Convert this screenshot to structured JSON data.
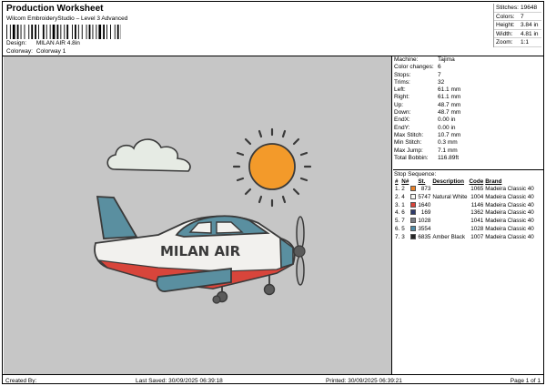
{
  "header": {
    "title": "Production Worksheet",
    "subtitle": "Wilcom EmbroideryStudio – Level 3 Advanced",
    "design_label": "Design:",
    "design_value": "MILAN AIR 4.8in",
    "colorway_label": "Colorway:",
    "colorway_value": "Colorway 1"
  },
  "summary": [
    {
      "label": "Stitches:",
      "value": "19648"
    },
    {
      "label": "Colors:",
      "value": "7"
    },
    {
      "label": "Height:",
      "value": "3.84 in"
    },
    {
      "label": "Width:",
      "value": "4.81 in"
    },
    {
      "label": "Zoom:",
      "value": "1:1"
    }
  ],
  "design_text": "MILAN AIR",
  "colors": {
    "canvas": "#c6c6c6",
    "sun": "#f39a2a",
    "cloud": "#e6ebe4",
    "plane_body": "#f2f1ee",
    "plane_blue": "#5a8fa0",
    "plane_red": "#d8453b",
    "outline": "#3a3a3a"
  },
  "machine_info": [
    {
      "label": "Machine:",
      "value": "Tajima"
    },
    {
      "label": "Color changes:",
      "value": "6"
    },
    {
      "label": "Stops:",
      "value": "7"
    },
    {
      "label": "Trims:",
      "value": "32"
    },
    {
      "label": "Left:",
      "value": "61.1 mm"
    },
    {
      "label": "Right:",
      "value": "61.1 mm"
    },
    {
      "label": "Up:",
      "value": "48.7 mm"
    },
    {
      "label": "Down:",
      "value": "48.7 mm"
    },
    {
      "label": "EndX:",
      "value": "0.00 in"
    },
    {
      "label": "EndY:",
      "value": "0.00 in"
    },
    {
      "label": "Max Stitch:",
      "value": "10.7 mm"
    },
    {
      "label": "Min Stitch:",
      "value": "0.3 mm"
    },
    {
      "label": "Max Jump:",
      "value": "7.1 mm"
    },
    {
      "label": "Total Bobbin:",
      "value": "116.89ft"
    }
  ],
  "stop_sequence": {
    "title": "Stop Sequence:",
    "headers": [
      "#",
      "N#",
      "",
      "St.",
      "Description",
      "Code",
      "Brand"
    ],
    "rows": [
      {
        "n": "1.",
        "nn": "2",
        "color": "#e8822a",
        "st": "873",
        "desc": "",
        "code": "1065",
        "brand": "Madeira Classic 40"
      },
      {
        "n": "2.",
        "nn": "4",
        "color": "#f7f7f2",
        "st": "5747",
        "desc": "Natural White",
        "code": "1004",
        "brand": "Madeira Classic 40"
      },
      {
        "n": "3.",
        "nn": "1",
        "color": "#d8453b",
        "st": "1640",
        "desc": "",
        "code": "1146",
        "brand": "Madeira Classic 40"
      },
      {
        "n": "4.",
        "nn": "6",
        "color": "#2f3b6b",
        "st": "169",
        "desc": "",
        "code": "1362",
        "brand": "Madeira Classic 40"
      },
      {
        "n": "5.",
        "nn": "7",
        "color": "#7a7f86",
        "st": "1028",
        "desc": "",
        "code": "1041",
        "brand": "Madeira Classic 40"
      },
      {
        "n": "6.",
        "nn": "5",
        "color": "#4f8ca7",
        "st": "3554",
        "desc": "",
        "code": "1028",
        "brand": "Madeira Classic 40"
      },
      {
        "n": "7.",
        "nn": "3",
        "color": "#262626",
        "st": "6835",
        "desc": "Amber Black",
        "code": "1007",
        "brand": "Madeira Classic 40"
      }
    ]
  },
  "footer": {
    "created": "Created By:",
    "saved": "Last Saved: 30/09/2025 06:39:18",
    "printed": "Printed: 30/09/2025 06:39:21",
    "page": "Page 1 of 1"
  }
}
